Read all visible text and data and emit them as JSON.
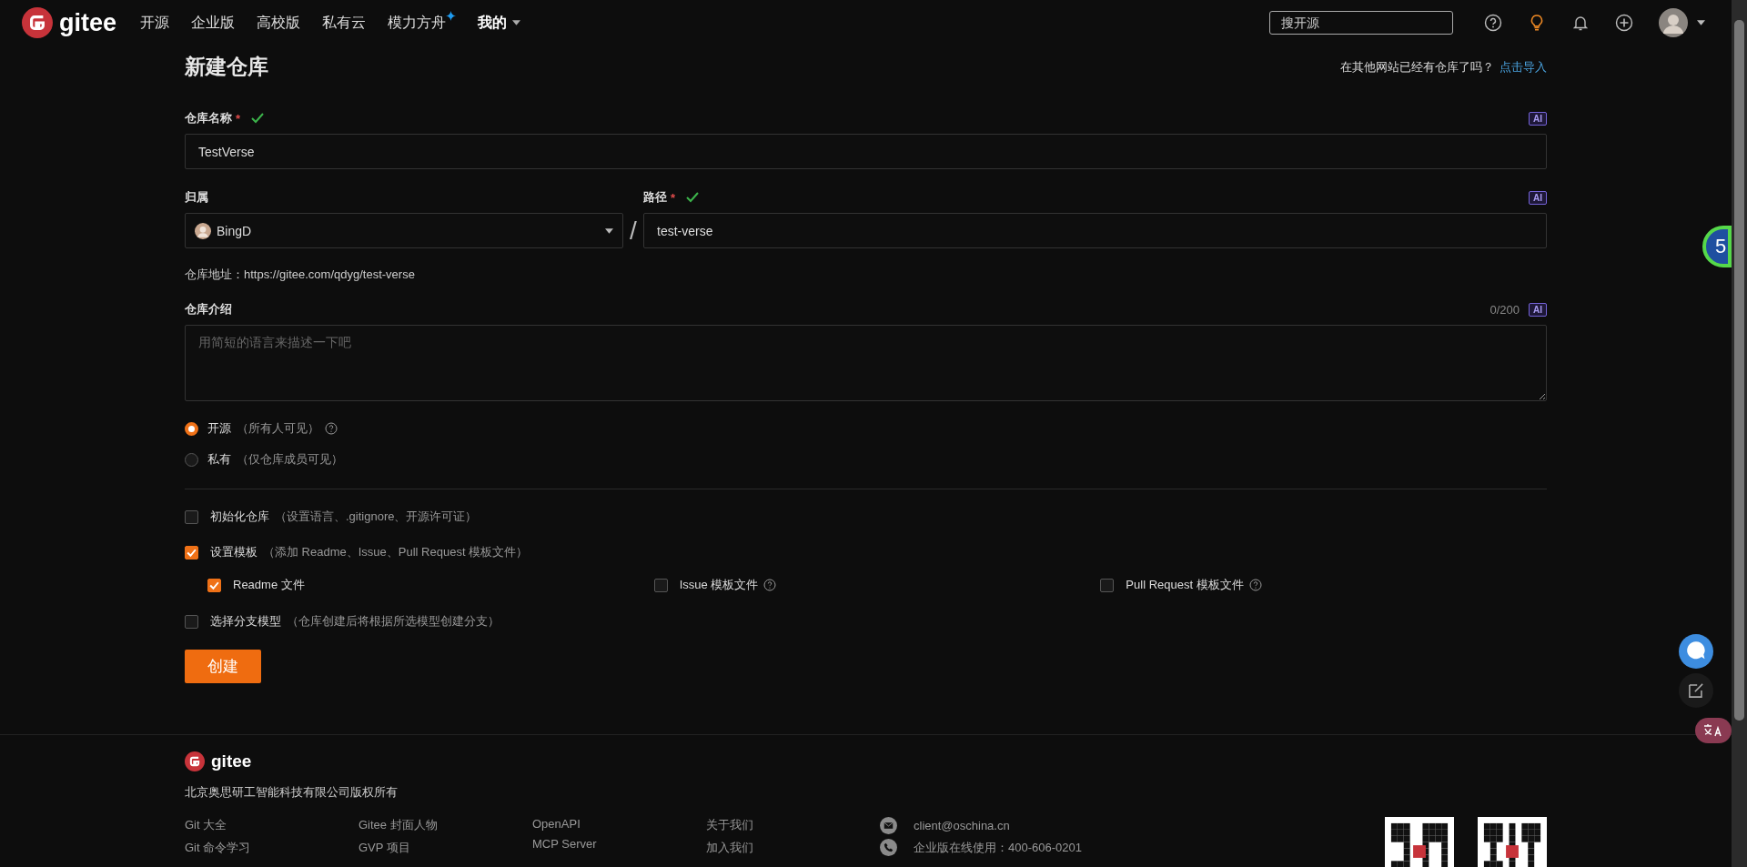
{
  "nav": {
    "logo": "gitee",
    "items": [
      {
        "label": "开源",
        "kind": "link"
      },
      {
        "label": "企业版",
        "kind": "link"
      },
      {
        "label": "高校版",
        "kind": "link"
      },
      {
        "label": "私有云",
        "kind": "link"
      },
      {
        "label": "模力方舟",
        "kind": "sparkle"
      },
      {
        "label": "我的",
        "kind": "dropdown"
      }
    ],
    "search": {
      "placeholder": "搜开源"
    }
  },
  "page": {
    "title": "新建仓库",
    "import_prompt": "在其他网站已经有仓库了吗？",
    "import_link": "点击导入"
  },
  "repo_name": {
    "label": "仓库名称",
    "required_mark": "*",
    "valid": true,
    "ai": "AI",
    "value": "TestVerse"
  },
  "owner": {
    "label": "归属",
    "value": "BingD"
  },
  "separator": "/",
  "path": {
    "label": "路径",
    "required_mark": "*",
    "valid": true,
    "ai": "AI",
    "value": "test-verse"
  },
  "address": "仓库地址：https://gitee.com/qdyg/test-verse",
  "intro": {
    "label": "仓库介绍",
    "counter": "0/200",
    "ai": "AI",
    "placeholder": "用简短的语言来描述一下吧"
  },
  "visibility": [
    {
      "label": "开源",
      "note": "（所有人可见）",
      "help": true,
      "selected": true
    },
    {
      "label": "私有",
      "note": "（仅仓库成员可见）",
      "help": false,
      "selected": false
    }
  ],
  "options": [
    {
      "label": "初始化仓库",
      "note": "（设置语言、.gitignore、开源许可证）",
      "checked": false
    },
    {
      "label": "设置模板",
      "note": "（添加 Readme、Issue、Pull Request 模板文件）",
      "checked": true,
      "children": [
        {
          "label": "Readme 文件",
          "checked": true,
          "help": false
        },
        {
          "label": "Issue 模板文件",
          "checked": false,
          "help": true
        },
        {
          "label": "Pull Request 模板文件",
          "checked": false,
          "help": true
        }
      ]
    },
    {
      "label": "选择分支模型",
      "note": "（仓库创建后将根据所选模型创建分支）",
      "checked": false
    }
  ],
  "submit": "创建",
  "footer": {
    "logo": "gitee",
    "company": "北京奥思研工智能科技有限公司版权所有",
    "columns": [
      [
        "Git 大全",
        "Git 命令学习"
      ],
      [
        "Gitee 封面人物",
        "GVP 项目"
      ],
      [
        "OpenAPI",
        "MCP Server"
      ],
      [
        "关于我们",
        "加入我们"
      ]
    ],
    "contacts": [
      {
        "kind": "mail",
        "text": "client@oschina.cn"
      },
      {
        "kind": "phone",
        "text": "企业版在线使用：400-606-0201"
      }
    ]
  },
  "side": {
    "badge": "5"
  }
}
